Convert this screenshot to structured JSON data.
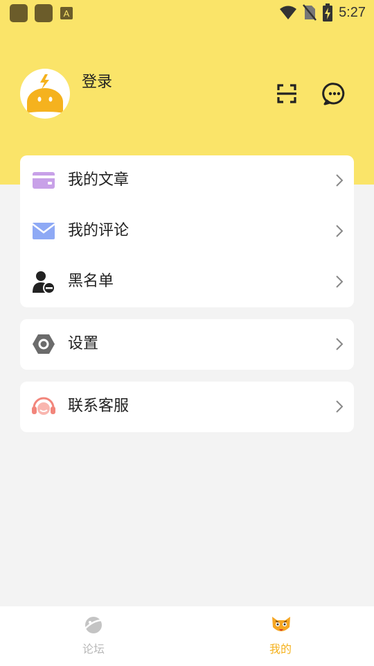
{
  "status_bar": {
    "time": "5:27"
  },
  "profile": {
    "login_label": "登录"
  },
  "menu_group_1": [
    {
      "label": "我的文章",
      "icon": "article-card-icon",
      "color": "#c8a1e8"
    },
    {
      "label": "我的评论",
      "icon": "envelope-icon",
      "color": "#8ea9f5"
    },
    {
      "label": "黑名单",
      "icon": "user-block-icon",
      "color": "#222222"
    }
  ],
  "menu_group_2": [
    {
      "label": "设置",
      "icon": "hexagon-settings-icon",
      "color": "#6b6b6b"
    }
  ],
  "menu_group_3": [
    {
      "label": "联系客服",
      "icon": "headset-icon",
      "color": "#f2857b"
    }
  ],
  "tabbar": {
    "forum_label": "论坛",
    "mine_label": "我的",
    "active_color": "#f5b21e",
    "inactive_color": "#b8b8b8"
  },
  "colors": {
    "header": "#fae469",
    "background": "#f3f3f3"
  }
}
